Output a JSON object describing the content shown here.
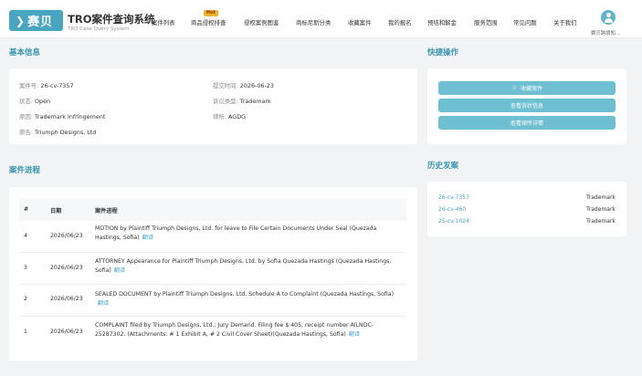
{
  "header": {
    "logo_text": "赛贝",
    "title": "TRO案件查询系统",
    "subtitle": "TRO Case Query System",
    "hot_badge": "Hot",
    "nav": [
      "案件列表",
      "商品侵权排查",
      "侵权案例图鉴",
      "商标尼斯分类",
      "收藏案件",
      "我的报名",
      "预结和解金",
      "服务范围",
      "常见问题",
      "关于我们"
    ],
    "user_name": "赛贝跨境知..."
  },
  "basic_info": {
    "title": "基本信息",
    "case_no_label": "案件号:",
    "case_no": "26-cv-7357",
    "filed_label": "提交时间:",
    "filed": "2026-06-23",
    "status_label": "状态:",
    "status": "Open",
    "type_label": "诉讼类型:",
    "type": "Trademark",
    "cause_label": "原因:",
    "cause": "Trademark Infringement",
    "firm_label": "律所:",
    "firm": "AGDG",
    "plaintiff_label": "原告:",
    "plaintiff": "Triumph Designs, Ltd"
  },
  "quick_actions": {
    "title": "快捷操作",
    "favorite": "收藏案件",
    "view_litigation": "查看诉状信息",
    "view_firm": "查看律所详情"
  },
  "history": {
    "title": "历史发案",
    "items": [
      {
        "case": "26-cv-7357",
        "type": "Trademark"
      },
      {
        "case": "26-cv-460",
        "type": "Trademark"
      },
      {
        "case": "25-cv-1024",
        "type": "Trademark"
      }
    ]
  },
  "progress": {
    "title": "案件进程",
    "col_num": "#",
    "col_date": "日期",
    "col_desc": "案件进程",
    "translate_label": "翻译",
    "rows": [
      {
        "num": "4",
        "date": "2026/06/23",
        "desc": "MOTION by Plaintiff Triumph Designs, Ltd. for leave to File Certain Documents Under Seal (Quezada Hastings, Sofia)"
      },
      {
        "num": "3",
        "date": "2026/06/23",
        "desc": "ATTORNEY Appearance for Plaintiff Triumph Designs, Ltd. by Sofia Quezada Hastings (Quezada Hastings, Sofia)"
      },
      {
        "num": "2",
        "date": "2026/06/23",
        "desc": "SEALED DOCUMENT by Plaintiff Triumph Designs, Ltd. Schedule A to Complaint (Quezada Hastings, Sofia)"
      },
      {
        "num": "1",
        "date": "2026/06/23",
        "desc": "COMPLAINT filed by Triumph Designs, Ltd.; Jury Demand. Filing fee $ 405, receipt number AILNDC-25287302. (Attachments: # 1 Exhibit A, # 2 Civil Cover Sheet)(Quezada Hastings, Sofia)"
      }
    ]
  },
  "colors": {
    "accent": "#4aa6c0",
    "button": "#6fbfd3",
    "hot": "#f5b22c",
    "background": "#f1f3f4"
  }
}
